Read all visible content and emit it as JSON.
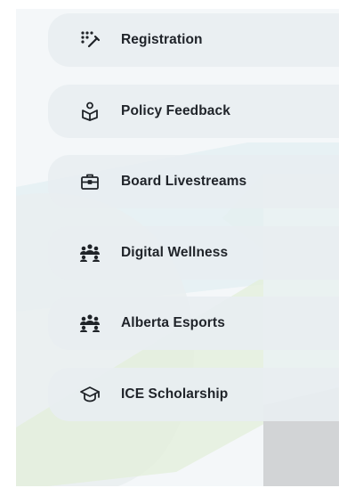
{
  "menu": {
    "items": [
      {
        "label": "Registration",
        "icon": "dots-pen-icon"
      },
      {
        "label": "Policy Feedback",
        "icon": "hand-heart-icon"
      },
      {
        "label": "Board Livestreams",
        "icon": "briefcase-icon"
      },
      {
        "label": "Digital Wellness",
        "icon": "people-group-icon"
      },
      {
        "label": "Alberta Esports",
        "icon": "people-group-icon"
      },
      {
        "label": "ICE Scholarship",
        "icon": "graduation-cap-icon"
      }
    ]
  },
  "colors": {
    "panel": "#f4f7f9",
    "item": "#e8eef1",
    "text": "#20242a",
    "accent_cyan": "#d6ecef",
    "accent_green": "#e2efd9",
    "accent_gray": "#d0d2d4"
  }
}
